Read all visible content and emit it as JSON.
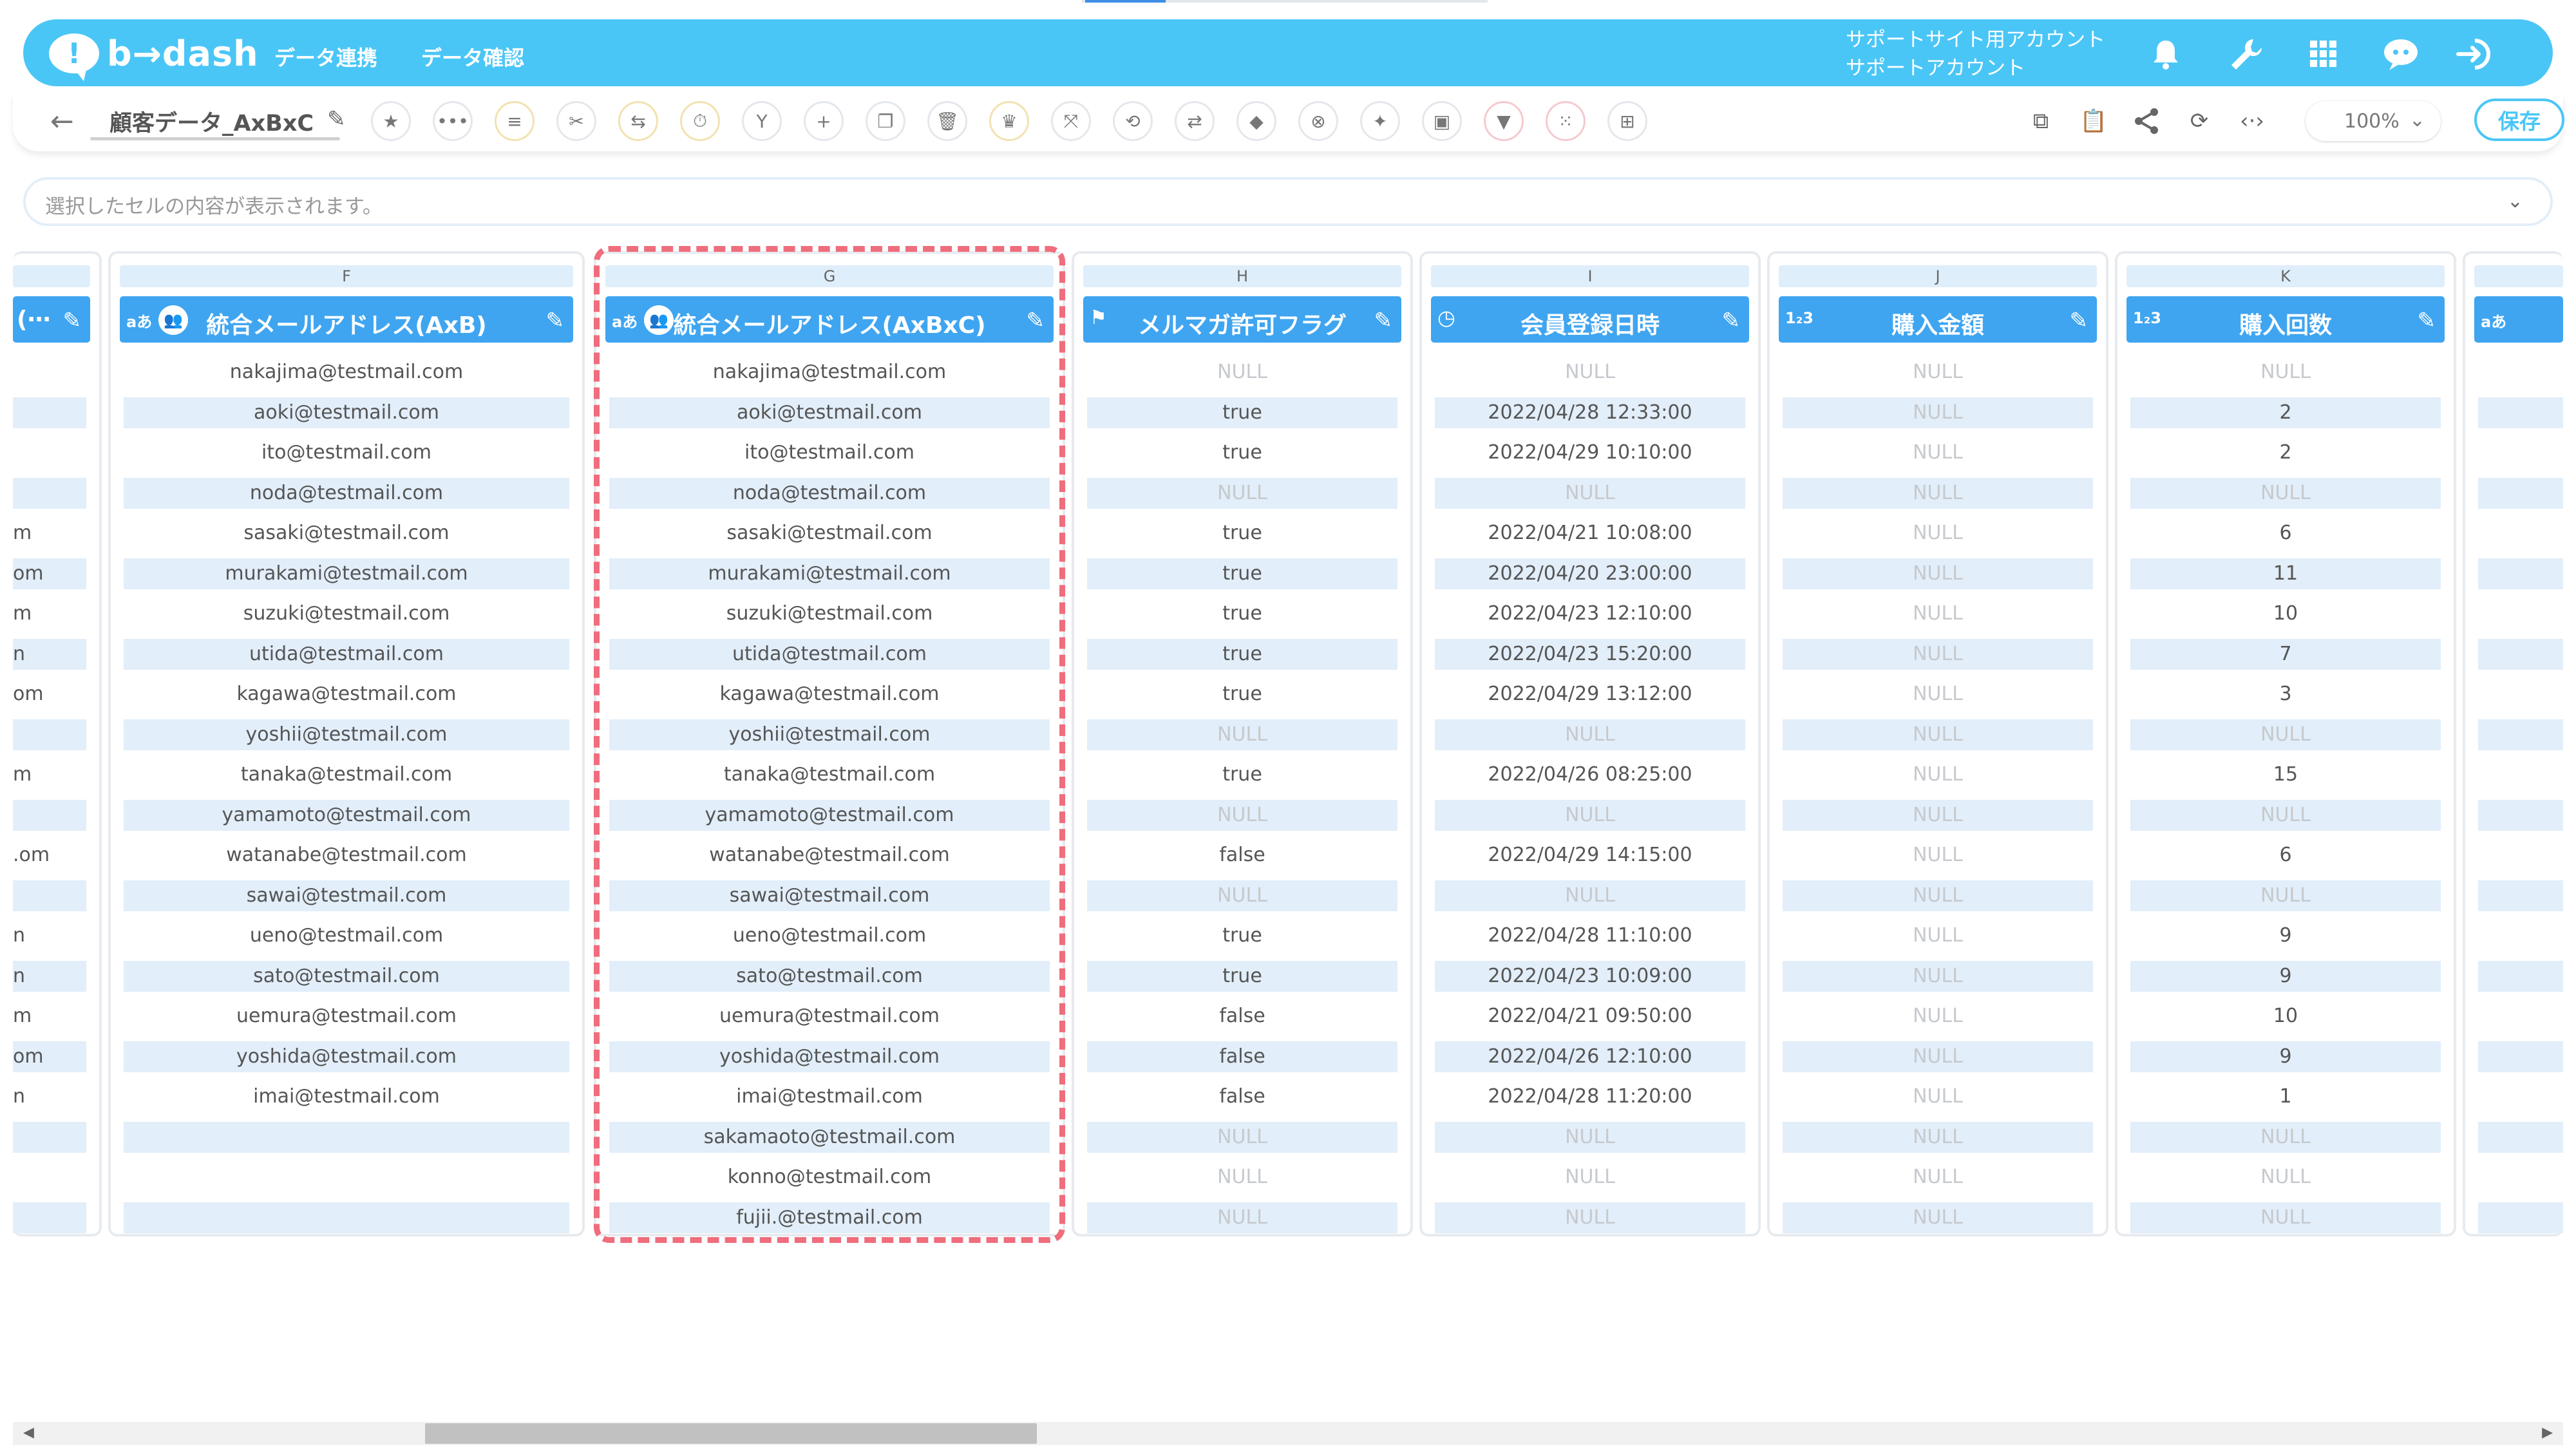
{
  "app": {
    "logo_glyph": "!",
    "logo_text": "b→dash",
    "nav": [
      "データ連携",
      "データ確認"
    ],
    "account_line1": "サポートサイト用アカウント",
    "account_line2": "サポートアカウント",
    "accent_color": "#4ac6f6"
  },
  "toolbar": {
    "back": "←",
    "sheet_name": "顧客データ_AxBxC",
    "zoom": "100%",
    "save": "保存",
    "tool_icons": [
      "star-icon",
      "more-icon",
      "list-icon",
      "tools-icon",
      "merge-icon",
      "timer-icon",
      "branch-icon",
      "plus-icon",
      "copy-icon",
      "trash-icon",
      "crown-icon",
      "expand-icon",
      "repeat-icon",
      "ab-icon",
      "bag-icon",
      "close-circle-icon",
      "ai-icon",
      "frame-icon",
      "filter-icon",
      "grid-dots-icon",
      "table-icon"
    ],
    "right_icons": [
      "flow-icon",
      "clipboard-icon",
      "share-icon",
      "refresh-icon",
      "code-icon"
    ]
  },
  "cellbar": {
    "placeholder": "選択したセルの内容が表示されます。"
  },
  "partial_left": {
    "title": "(⋯",
    "cells": [
      "",
      "",
      "",
      "",
      "m",
      "om",
      "m",
      "n",
      "om",
      "",
      "m",
      "",
      ".om",
      "",
      "n",
      "n",
      "m",
      "om",
      "n",
      "",
      "",
      ""
    ]
  },
  "columns": [
    {
      "letter": "F",
      "type": "aあ",
      "has_person_icon": true,
      "title": "統合メールアドレス(AxB)",
      "cells": [
        "nakajima@testmail.com",
        "aoki@testmail.com",
        "ito@testmail.com",
        "noda@testmail.com",
        "sasaki@testmail.com",
        "murakami@testmail.com",
        "suzuki@testmail.com",
        "utida@testmail.com",
        "kagawa@testmail.com",
        "yoshii@testmail.com",
        "tanaka@testmail.com",
        "yamamoto@testmail.com",
        "watanabe@testmail.com",
        "sawai@testmail.com",
        "ueno@testmail.com",
        "sato@testmail.com",
        "uemura@testmail.com",
        "yoshida@testmail.com",
        "imai@testmail.com",
        "",
        "",
        ""
      ]
    },
    {
      "letter": "G",
      "type": "aあ",
      "has_person_icon": true,
      "title": "統合メールアドレス(AxBxC)",
      "cells": [
        "nakajima@testmail.com",
        "aoki@testmail.com",
        "ito@testmail.com",
        "noda@testmail.com",
        "sasaki@testmail.com",
        "murakami@testmail.com",
        "suzuki@testmail.com",
        "utida@testmail.com",
        "kagawa@testmail.com",
        "yoshii@testmail.com",
        "tanaka@testmail.com",
        "yamamoto@testmail.com",
        "watanabe@testmail.com",
        "sawai@testmail.com",
        "ueno@testmail.com",
        "sato@testmail.com",
        "uemura@testmail.com",
        "yoshida@testmail.com",
        "imai@testmail.com",
        "sakamaoto@testmail.com",
        "konno@testmail.com",
        "fujii.@testmail.com"
      ]
    },
    {
      "letter": "H",
      "type": "flag",
      "title": "メルマガ許可フラグ",
      "cells": [
        "NULL",
        "true",
        "true",
        "NULL",
        "true",
        "true",
        "true",
        "true",
        "true",
        "NULL",
        "true",
        "NULL",
        "false",
        "NULL",
        "true",
        "true",
        "false",
        "false",
        "false",
        "NULL",
        "NULL",
        "NULL"
      ]
    },
    {
      "letter": "I",
      "type": "clock",
      "title": "会員登録日時",
      "cells": [
        "NULL",
        "2022/04/28 12:33:00",
        "2022/04/29 10:10:00",
        "NULL",
        "2022/04/21 10:08:00",
        "2022/04/20 23:00:00",
        "2022/04/23 12:10:00",
        "2022/04/23 15:20:00",
        "2022/04/29 13:12:00",
        "NULL",
        "2022/04/26 08:25:00",
        "NULL",
        "2022/04/29 14:15:00",
        "NULL",
        "2022/04/28 11:10:00",
        "2022/04/23 10:09:00",
        "2022/04/21 09:50:00",
        "2022/04/26 12:10:00",
        "2022/04/28 11:20:00",
        "NULL",
        "NULL",
        "NULL"
      ]
    },
    {
      "letter": "J",
      "type": "1₂3",
      "title": "購入金額",
      "cells": [
        "NULL",
        "NULL",
        "NULL",
        "NULL",
        "NULL",
        "NULL",
        "NULL",
        "NULL",
        "NULL",
        "NULL",
        "NULL",
        "NULL",
        "NULL",
        "NULL",
        "NULL",
        "NULL",
        "NULL",
        "NULL",
        "NULL",
        "NULL",
        "NULL",
        "NULL"
      ]
    },
    {
      "letter": "K",
      "type": "1₂3",
      "title": "購入回数",
      "cells": [
        "NULL",
        "2",
        "2",
        "NULL",
        "6",
        "11",
        "10",
        "7",
        "3",
        "NULL",
        "15",
        "NULL",
        "6",
        "NULL",
        "9",
        "9",
        "10",
        "9",
        "1",
        "NULL",
        "NULL",
        "NULL"
      ]
    }
  ],
  "partial_right": {
    "type": "aあ"
  }
}
